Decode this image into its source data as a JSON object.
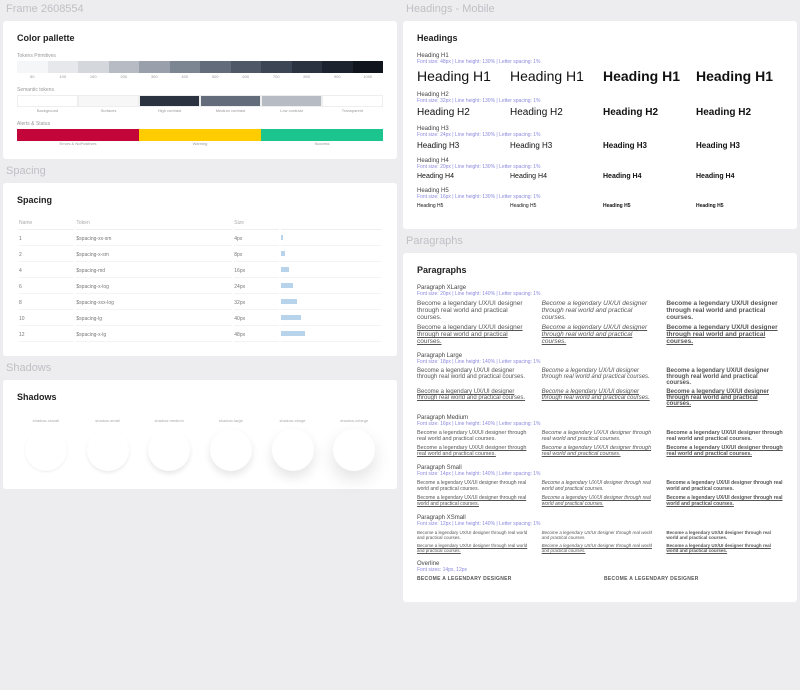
{
  "left": {
    "frame_label": "Frame 2608554",
    "palette": {
      "title": "Color pallette",
      "primitives_label": "Tokens Primitives",
      "swatches": [
        {
          "v": "50",
          "c": "#f5f6f7"
        },
        {
          "v": "100",
          "c": "#e6e8eb"
        },
        {
          "v": "150",
          "c": "#d4d7dc"
        },
        {
          "v": "200",
          "c": "#b7bcc4"
        },
        {
          "v": "300",
          "c": "#99a0ab"
        },
        {
          "v": "400",
          "c": "#7c8592"
        },
        {
          "v": "500",
          "c": "#636c7a"
        },
        {
          "v": "600",
          "c": "#4f5866"
        },
        {
          "v": "700",
          "c": "#3c4553"
        },
        {
          "v": "800",
          "c": "#2b3240"
        },
        {
          "v": "900",
          "c": "#1c222e"
        },
        {
          "v": "1000",
          "c": "#10141c"
        }
      ],
      "semantic_label": "Semantic tokens",
      "semantics": [
        {
          "n": "Background",
          "c": "#ffffff"
        },
        {
          "n": "Surfaces",
          "c": "#f7f7f8"
        },
        {
          "n": "High contrast",
          "c": "#2b3240"
        },
        {
          "n": "Medium contrast",
          "c": "#636c7a"
        },
        {
          "n": "Low contrast",
          "c": "#b7bcc4"
        },
        {
          "n": "Transparent",
          "c": "#ffffff"
        }
      ],
      "alerts_label": "Alerts & Status",
      "alerts": [
        {
          "n": "Errors & NoPositives",
          "c": "#c4053a"
        },
        {
          "n": "Warning",
          "c": "#ffcc00"
        },
        {
          "n": "Success",
          "c": "#1bc58d"
        }
      ]
    },
    "spacing": {
      "label": "Spacing",
      "title": "Spacing",
      "cols": [
        "Name",
        "Token",
        "Size"
      ],
      "rows": [
        {
          "n": "1",
          "t": "$spacing-xx-sm",
          "s": "4px",
          "w": 2
        },
        {
          "n": "2",
          "t": "$spacing-x-sm",
          "s": "8px",
          "w": 4
        },
        {
          "n": "4",
          "t": "$spacing-md",
          "s": "16px",
          "w": 8
        },
        {
          "n": "6",
          "t": "$spacing-x-log",
          "s": "24px",
          "w": 12
        },
        {
          "n": "8",
          "t": "$spacing-xxx-log",
          "s": "32px",
          "w": 16
        },
        {
          "n": "10",
          "t": "$spacing-lg",
          "s": "40px",
          "w": 20
        },
        {
          "n": "12",
          "t": "$spacing-x-lg",
          "s": "48px",
          "w": 24
        }
      ]
    },
    "shadows": {
      "label": "Shadows",
      "title": "Shadows",
      "items": [
        {
          "n": "shadow-xsmall",
          "s": "0 1px 2px rgba(0,0,0,.07)"
        },
        {
          "n": "shadow-small",
          "s": "0 2px 3px rgba(0,0,0,.08)"
        },
        {
          "n": "shadow-medium",
          "s": "0 3px 5px rgba(0,0,0,.09)"
        },
        {
          "n": "shadow-large",
          "s": "0 4px 8px rgba(0,0,0,.10)"
        },
        {
          "n": "shadow-xlarge",
          "s": "0 6px 12px rgba(0,0,0,.11)"
        },
        {
          "n": "shadow-xxlarge",
          "s": "0 8px 18px rgba(0,0,0,.12)"
        }
      ]
    }
  },
  "right": {
    "headings": {
      "label": "Headings - Mobile",
      "title": "Headings",
      "list": [
        {
          "name": "Heading H1",
          "meta": "Font size: 48px | Line height: 130% | Letter spacing: 1%",
          "sample": "Heading H1",
          "fs": 14
        },
        {
          "name": "Heading H2",
          "meta": "Font size: 32px | Line height: 130% | Letter spacing: 1%",
          "sample": "Heading H2",
          "fs": 10
        },
        {
          "name": "Heading H3",
          "meta": "Font size: 24px | Line height: 130% | Letter spacing: 1%",
          "sample": "Heading H3",
          "fs": 8
        },
        {
          "name": "Heading H4",
          "meta": "Font size: 20px | Line height: 130% | Letter spacing: 1%",
          "sample": "Heading H4",
          "fs": 7
        },
        {
          "name": "Heading H5",
          "meta": "Font size: 16px | Line height: 130% | Letter spacing: 1%",
          "sample": "Heading H5",
          "fs": 5
        }
      ]
    },
    "paragraphs": {
      "label": "Paragraphs",
      "title": "Paragraphs",
      "sample": "Become a legendary UX/UI designer through real world and practical courses.",
      "sample_short": "Become a legendary UX/UI designer through real world and practical courses.",
      "list": [
        {
          "name": "Paragraph XLarge",
          "meta": "Font size: 20px | Line height: 140% | Letter spacing: 1%",
          "fs": 6.5
        },
        {
          "name": "Paragraph Large",
          "meta": "Font size: 18px | Line height: 140% | Letter spacing: 1%",
          "fs": 6
        },
        {
          "name": "Paragraph Medium",
          "meta": "Font size: 16px | Line height: 140% | Letter spacing: 1%",
          "fs": 5.5
        },
        {
          "name": "Paragraph Small",
          "meta": "Font size: 14px | Line height: 140% | Letter spacing: 1%",
          "fs": 5
        },
        {
          "name": "Paragraph XSmall",
          "meta": "Font size: 12px | Line height: 140% | Letter spacing: 1%",
          "fs": 4.5
        }
      ],
      "overline": {
        "name": "Overline",
        "meta": "Font sizes: 14px, 12px",
        "sample": "Become a legendary designer"
      }
    }
  }
}
